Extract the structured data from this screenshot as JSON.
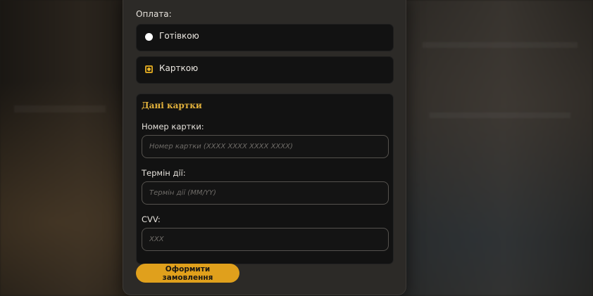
{
  "payment": {
    "label": "Оплата:",
    "options": [
      {
        "label": "Готівкою",
        "selected": false
      },
      {
        "label": "Карткою",
        "selected": true
      }
    ]
  },
  "card_details": {
    "title": "Дані картки",
    "fields": [
      {
        "label": "Номер картки:",
        "placeholder": "Номер картки (XXXX XXXX XXXX XXXX)",
        "value": ""
      },
      {
        "label": "Термін дії:",
        "placeholder": "Термін дії (MM/YY)",
        "value": ""
      },
      {
        "label": "CVV:",
        "placeholder": "XXX",
        "value": ""
      }
    ]
  },
  "submit": {
    "label": "Оформити замовлення"
  },
  "colors": {
    "accent": "#e0a01c",
    "title_accent": "#e2b13c",
    "card_bg": "#2c2a27",
    "panel_bg": "#121212"
  },
  "icons": {
    "radio_unselected": "radio-circle-white",
    "radio_selected": "radio-circle-gold"
  }
}
